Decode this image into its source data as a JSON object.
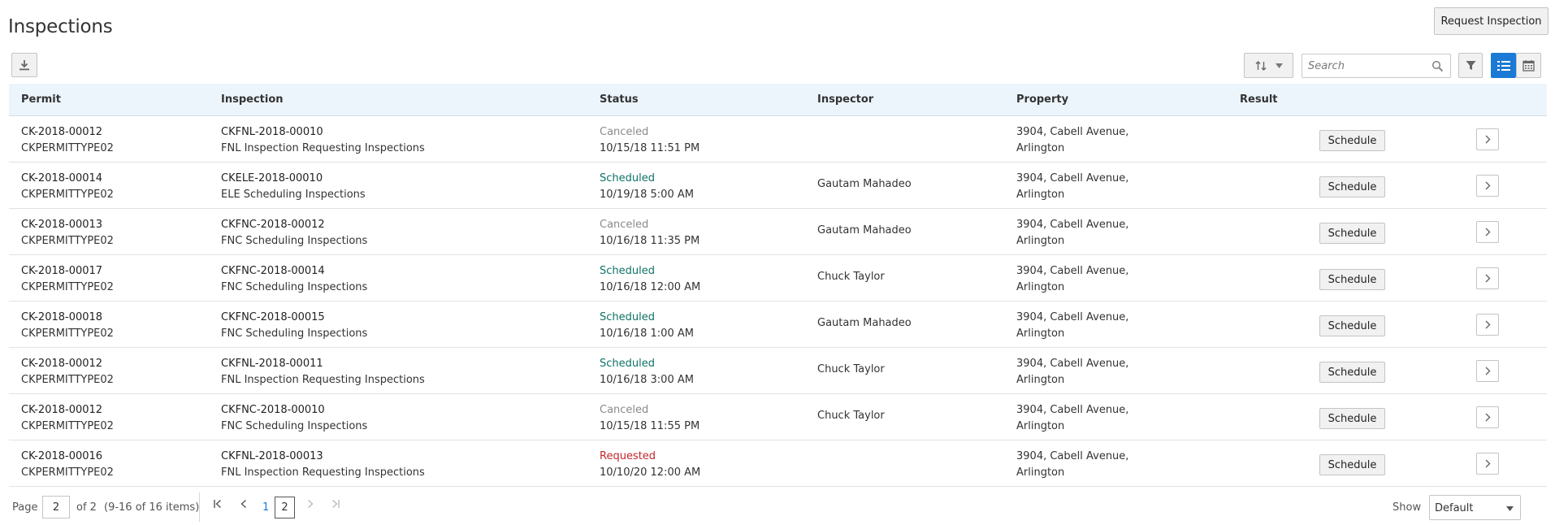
{
  "header": {
    "title": "Inspections",
    "request_button": "Request Inspection"
  },
  "toolbar": {
    "search_placeholder": "Search",
    "icons": [
      "download-icon",
      "sort-icon",
      "chevron-down-icon",
      "search-icon",
      "filter-icon",
      "list-view-icon",
      "calendar-view-icon"
    ]
  },
  "columns": [
    "Permit",
    "Inspection",
    "Status",
    "Inspector",
    "Property",
    "Result"
  ],
  "rows": [
    {
      "permit": "CK-2018-00012",
      "permit_type": "CKPERMITTYPE02",
      "inspection": "CKFNL-2018-00010",
      "inspection_desc": "FNL Inspection Requesting Inspections",
      "status": "Canceled",
      "datetime": "10/15/18 11:51 PM",
      "inspector": "",
      "address1": "3904, Cabell Avenue,",
      "address2": "Arlington",
      "action": "Schedule"
    },
    {
      "permit": "CK-2018-00014",
      "permit_type": "CKPERMITTYPE02",
      "inspection": "CKELE-2018-00010",
      "inspection_desc": "ELE Scheduling Inspections",
      "status": "Scheduled",
      "datetime": "10/19/18 5:00 AM",
      "inspector": "Gautam Mahadeo",
      "address1": "3904, Cabell Avenue,",
      "address2": "Arlington",
      "action": "Schedule"
    },
    {
      "permit": "CK-2018-00013",
      "permit_type": "CKPERMITTYPE02",
      "inspection": "CKFNC-2018-00012",
      "inspection_desc": "FNC Scheduling Inspections",
      "status": "Canceled",
      "datetime": "10/16/18 11:35 PM",
      "inspector": "Gautam Mahadeo",
      "address1": "3904, Cabell Avenue,",
      "address2": "Arlington",
      "action": "Schedule"
    },
    {
      "permit": "CK-2018-00017",
      "permit_type": "CKPERMITTYPE02",
      "inspection": "CKFNC-2018-00014",
      "inspection_desc": "FNC Scheduling Inspections",
      "status": "Scheduled",
      "datetime": "10/16/18 12:00 AM",
      "inspector": "Chuck Taylor",
      "address1": "3904, Cabell Avenue,",
      "address2": "Arlington",
      "action": "Schedule"
    },
    {
      "permit": "CK-2018-00018",
      "permit_type": "CKPERMITTYPE02",
      "inspection": "CKFNC-2018-00015",
      "inspection_desc": "FNC Scheduling Inspections",
      "status": "Scheduled",
      "datetime": "10/16/18 1:00 AM",
      "inspector": "Gautam Mahadeo",
      "address1": "3904, Cabell Avenue,",
      "address2": "Arlington",
      "action": "Schedule"
    },
    {
      "permit": "CK-2018-00012",
      "permit_type": "CKPERMITTYPE02",
      "inspection": "CKFNL-2018-00011",
      "inspection_desc": "FNL Inspection Requesting Inspections",
      "status": "Scheduled",
      "datetime": "10/16/18 3:00 AM",
      "inspector": "Chuck Taylor",
      "address1": "3904, Cabell Avenue,",
      "address2": "Arlington",
      "action": "Schedule"
    },
    {
      "permit": "CK-2018-00012",
      "permit_type": "CKPERMITTYPE02",
      "inspection": "CKFNC-2018-00010",
      "inspection_desc": "FNC Scheduling Inspections",
      "status": "Canceled",
      "datetime": "10/15/18 11:55 PM",
      "inspector": "Chuck Taylor",
      "address1": "3904, Cabell Avenue,",
      "address2": "Arlington",
      "action": "Schedule"
    },
    {
      "permit": "CK-2018-00016",
      "permit_type": "CKPERMITTYPE02",
      "inspection": "CKFNL-2018-00013",
      "inspection_desc": "FNL Inspection Requesting Inspections",
      "status": "Requested",
      "datetime": "10/10/20 12:00 AM",
      "inspector": "",
      "address1": "3904, Cabell Avenue,",
      "address2": "Arlington",
      "action": "Schedule"
    }
  ],
  "pagination": {
    "page_label": "Page",
    "page_value": "2",
    "of_label": "of 2",
    "range_label": "(9-16 of 16 items)",
    "page_1": "1",
    "page_2": "2",
    "show_label": "Show",
    "show_value": "Default"
  },
  "colors": {
    "accent": "#1b7ad6",
    "header_bg": "#edf5fc",
    "scheduled": "#0f7268",
    "canceled": "#8a8a8a",
    "requested": "#c0262d"
  }
}
